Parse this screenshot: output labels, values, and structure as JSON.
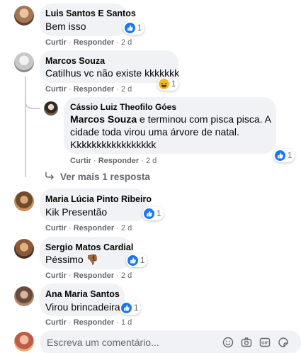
{
  "comments": [
    {
      "author": "Luis Santos E Santos",
      "text": "Bem isso",
      "actions": {
        "like": "Curtir",
        "reply": "Responder",
        "time": "2 d"
      },
      "reaction": {
        "icon": "like-icon",
        "count": "1"
      }
    },
    {
      "author": "Marcos Souza",
      "text": "Catilhus vc não existe kkkkkkk",
      "actions": {
        "like": "Curtir",
        "reply": "Responder",
        "time": "2 d"
      },
      "reaction": {
        "icon": "haha-icon",
        "count": "1"
      },
      "reply": {
        "author": "Cássio Luiz Theofilo Góes",
        "mention": "Marcos Souza",
        "text_line1": " e terminou com pisca pisca. A",
        "text_line2": "cidade toda virou uma árvore de natal.",
        "text_line3": "Kkkkkkkkkkkkkkkkk",
        "actions": {
          "like": "Curtir",
          "reply": "Responder",
          "time": "2 d"
        },
        "reaction": {
          "icon": "like-icon",
          "count": "1"
        }
      },
      "more_replies": "Ver mais 1 resposta"
    },
    {
      "author": "Maria Lúcia Pinto Ribeiro",
      "text": "Kik Presentão",
      "actions": {
        "like": "Curtir",
        "reply": "Responder",
        "time": "2 d"
      },
      "reaction": {
        "icon": "like-icon",
        "count": "1"
      }
    },
    {
      "author": "Sergio Matos Cardial",
      "text": "Péssimo 👎🏾",
      "actions": {
        "like": "Curtir",
        "reply": "Responder",
        "time": "2 d"
      },
      "reaction": {
        "icon": "like-icon",
        "count": "1"
      }
    },
    {
      "author": "Ana Maria Santos",
      "text": "Virou brincadeira",
      "actions": {
        "like": "Curtir",
        "reply": "Responder",
        "time": "1 d"
      },
      "reaction": {
        "icon": "like-icon",
        "count": "1"
      }
    }
  ],
  "composer": {
    "placeholder": "Escreva um comentário...",
    "icons": [
      "emoji-icon",
      "camera-icon",
      "gif-icon",
      "sticker-icon"
    ]
  },
  "colors": {
    "like_blue": "#1877f2",
    "haha_yellow": "#f7b928",
    "bubble": "#f0f2f5",
    "meta_gray": "#65676b"
  }
}
